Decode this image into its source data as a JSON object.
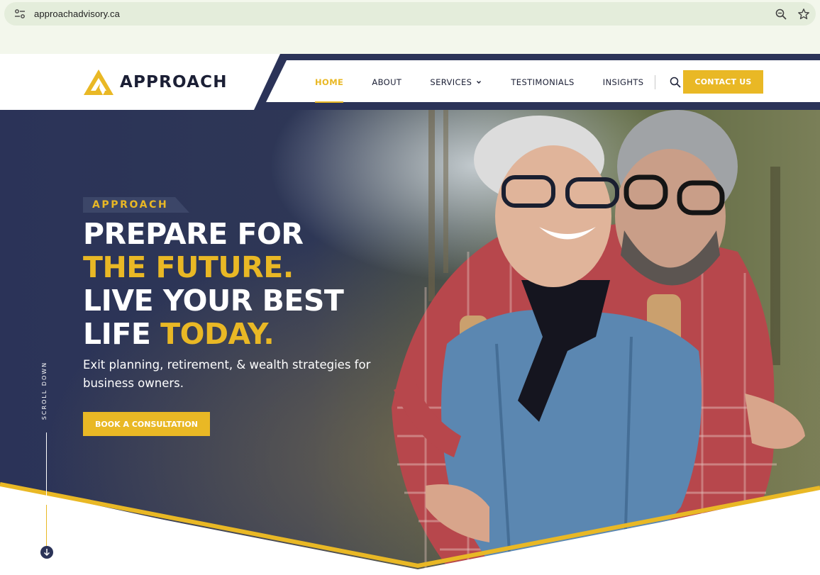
{
  "browser": {
    "url": "approachadvisory.ca",
    "icons": [
      "site-info-icon",
      "zoom-icon",
      "star-icon"
    ]
  },
  "header": {
    "logo_text": "APPROACH",
    "nav": [
      {
        "label": "HOME",
        "active": true
      },
      {
        "label": "ABOUT"
      },
      {
        "label": "SERVICES",
        "has_dropdown": true
      },
      {
        "label": "TESTIMONIALS"
      },
      {
        "label": "INSIGHTS"
      }
    ],
    "contact_label": "CONTACT US"
  },
  "hero": {
    "eyebrow": "APPROACH",
    "headline": {
      "line1": "PREPARE FOR",
      "line2": "THE FUTURE.",
      "line3": "LIVE YOUR BEST",
      "line4_white": "LIFE ",
      "line4_gold": "TODAY."
    },
    "subtext": "Exit planning, retirement, & wealth strategies for business owners.",
    "cta_label": "BOOK A CONSULTATION",
    "scroll_label": "SCROLL DOWN"
  },
  "colors": {
    "navy": "#2b3358",
    "gold": "#e9b825",
    "dark_text": "#1b1f35"
  }
}
